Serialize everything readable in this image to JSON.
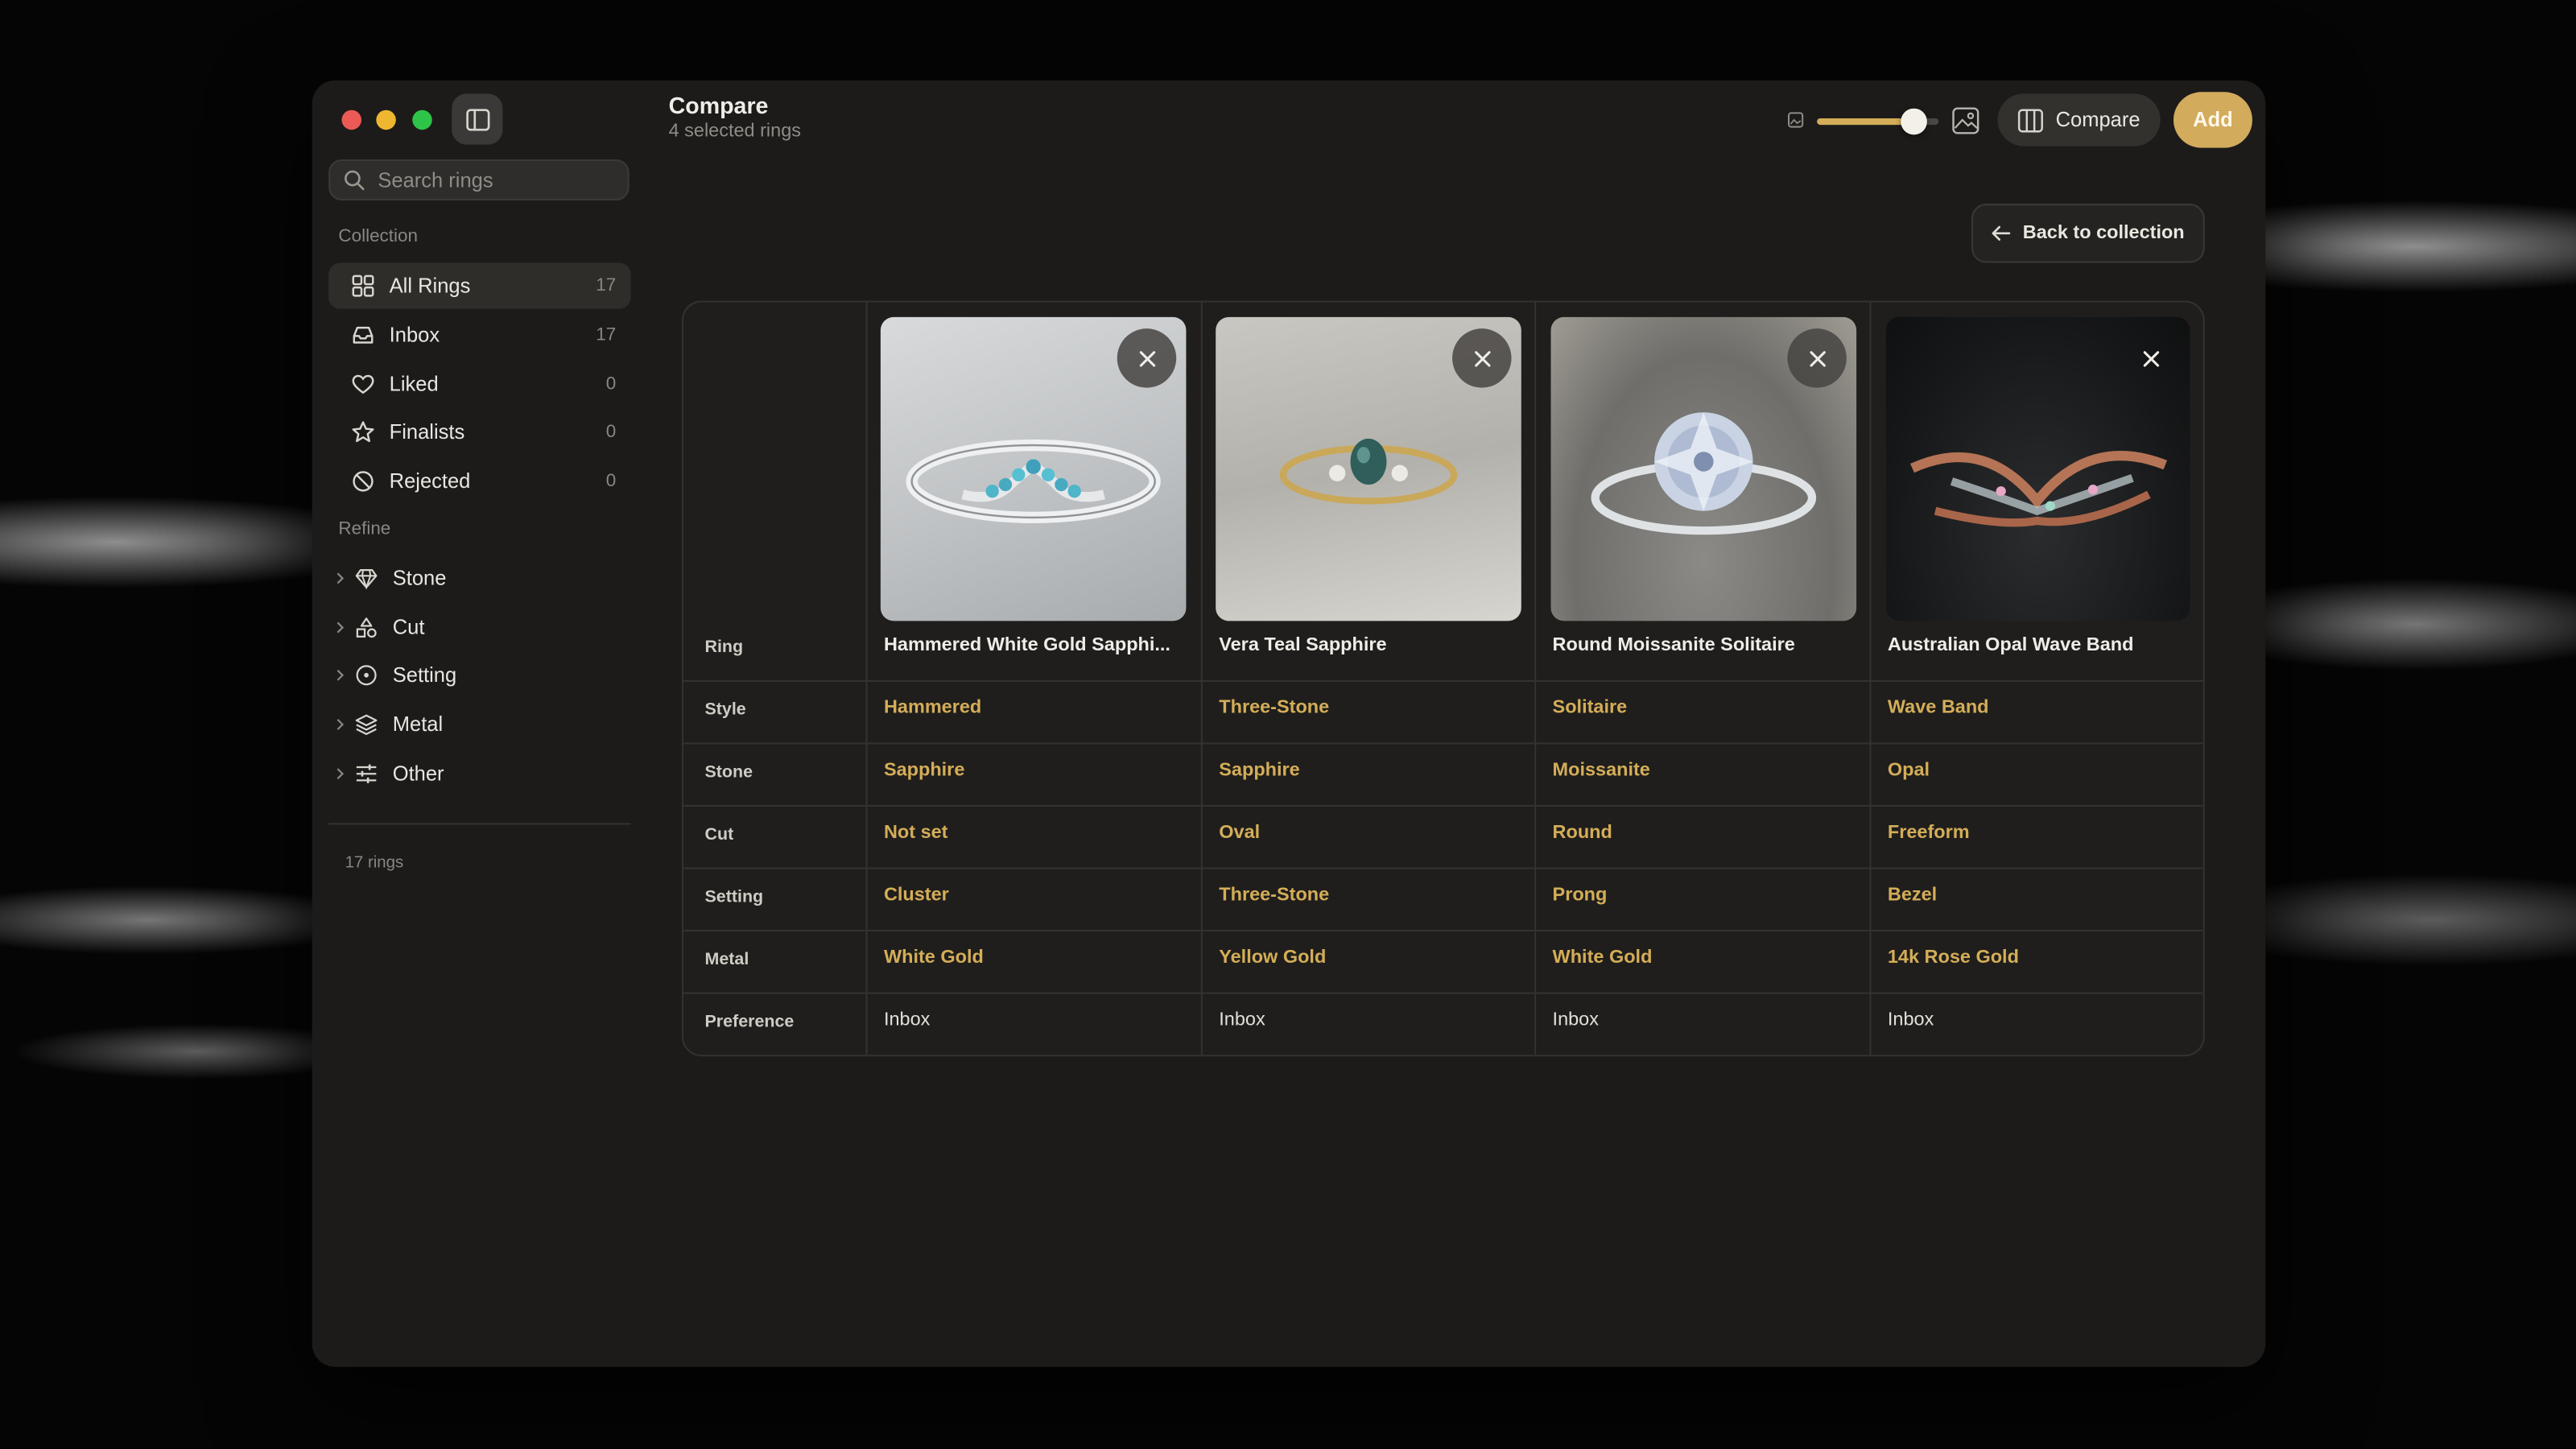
{
  "window": {
    "title": "Compare",
    "subtitle": "4 selected rings"
  },
  "sidebar": {
    "search_placeholder": "Search rings",
    "collection_label": "Collection",
    "collection": [
      {
        "label": "All Rings",
        "count": "17",
        "icon": "grid-icon",
        "active": true
      },
      {
        "label": "Inbox",
        "count": "17",
        "icon": "inbox-icon",
        "active": false
      },
      {
        "label": "Liked",
        "count": "0",
        "icon": "heart-icon",
        "active": false
      },
      {
        "label": "Finalists",
        "count": "0",
        "icon": "star-icon",
        "active": false
      },
      {
        "label": "Rejected",
        "count": "0",
        "icon": "prohibited-icon",
        "active": false
      }
    ],
    "refine_label": "Refine",
    "refine": [
      {
        "label": "Stone",
        "icon": "diamond-icon"
      },
      {
        "label": "Cut",
        "icon": "shapes-icon"
      },
      {
        "label": "Setting",
        "icon": "target-icon"
      },
      {
        "label": "Metal",
        "icon": "layers-icon"
      },
      {
        "label": "Other",
        "icon": "sliders-icon"
      }
    ],
    "footer": "17 rings"
  },
  "toolbar": {
    "size_slider_value": 0.8,
    "compare_label": "Compare",
    "add_label": "Add"
  },
  "back_label": "Back to collection",
  "compare_table": {
    "row_labels": {
      "ring": "Ring",
      "style": "Style",
      "stone": "Stone",
      "cut": "Cut",
      "setting": "Setting",
      "metal": "Metal",
      "preference": "Preference"
    },
    "rings": [
      {
        "name": "Hammered White Gold Sapphi...",
        "style": "Hammered",
        "stone": "Sapphire",
        "cut": "Not set",
        "setting": "Cluster",
        "metal": "White Gold",
        "preference": "Inbox"
      },
      {
        "name": "Vera Teal Sapphire",
        "style": "Three-Stone",
        "stone": "Sapphire",
        "cut": "Oval",
        "setting": "Three-Stone",
        "metal": "Yellow Gold",
        "preference": "Inbox"
      },
      {
        "name": "Round Moissanite Solitaire",
        "style": "Solitaire",
        "stone": "Moissanite",
        "cut": "Round",
        "setting": "Prong",
        "metal": "White Gold",
        "preference": "Inbox"
      },
      {
        "name": "Australian Opal Wave Band",
        "style": "Wave Band",
        "stone": "Opal",
        "cut": "Freeform",
        "setting": "Bezel",
        "metal": "14k Rose Gold",
        "preference": "Inbox"
      }
    ]
  },
  "colors": {
    "accent": "#d2ab5c",
    "window_bg": "#1c1b1a",
    "close_red": "#ec5a55",
    "minimize_yellow": "#efb72f",
    "maximize_green": "#2ec447"
  }
}
